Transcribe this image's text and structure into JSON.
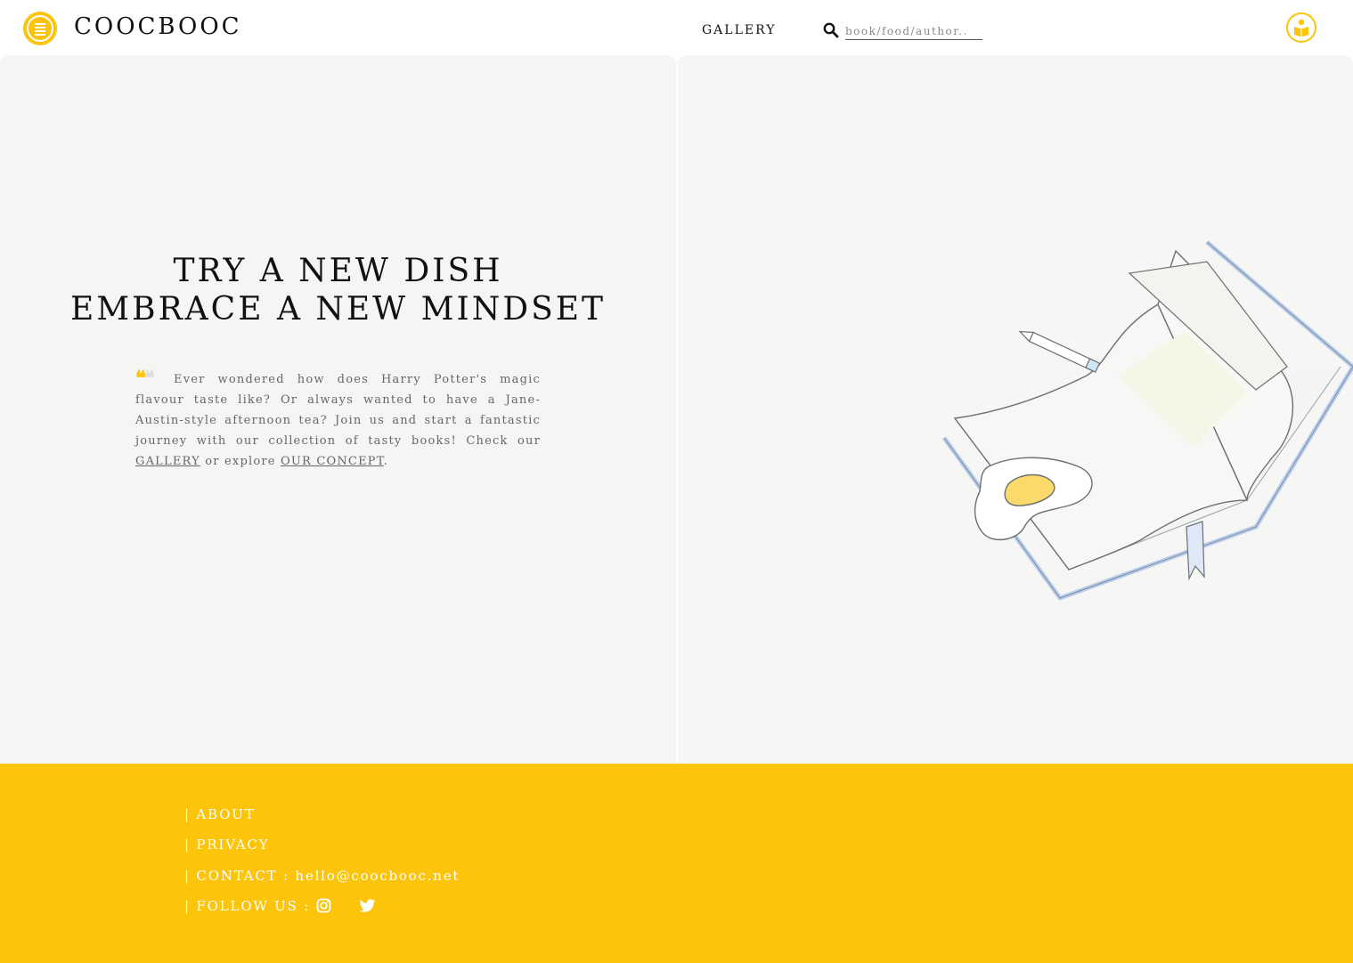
{
  "header": {
    "brand": "COOCBOOC",
    "nav_gallery": "GALLERY",
    "search_placeholder": "book/food/author.."
  },
  "hero": {
    "headline_line1": "TRY A NEW DISH",
    "headline_line2": "EMBRACE A NEW MINDSET",
    "quote_mark": "❝",
    "intro_text": "Ever wondered how does Harry Potter's magic flavour taste like? Or always wanted to have a Jane-Austin-style afternoon tea? Join us and start a fantastic journey with our collection of tasty books! Check our",
    "gallery_link": "GALLERY",
    "or_explore": "or explore",
    "concept_link": "OUR CONCEPT",
    "end_punct": "."
  },
  "footer": {
    "about": "| ABOUT",
    "privacy": "| PRIVACY",
    "contact_label": "| CONTACT : ",
    "contact_email": "hello@coocbooc.net",
    "follow_label": "| FOLLOW US :"
  },
  "colors": {
    "accent": "#fcc40a",
    "panel_bg": "#f5f6f4",
    "footer_text": "#ffffff"
  },
  "icons": [
    "menu-icon",
    "search-icon",
    "user-book-icon",
    "quote-icon",
    "instagram-icon",
    "twitter-icon"
  ]
}
